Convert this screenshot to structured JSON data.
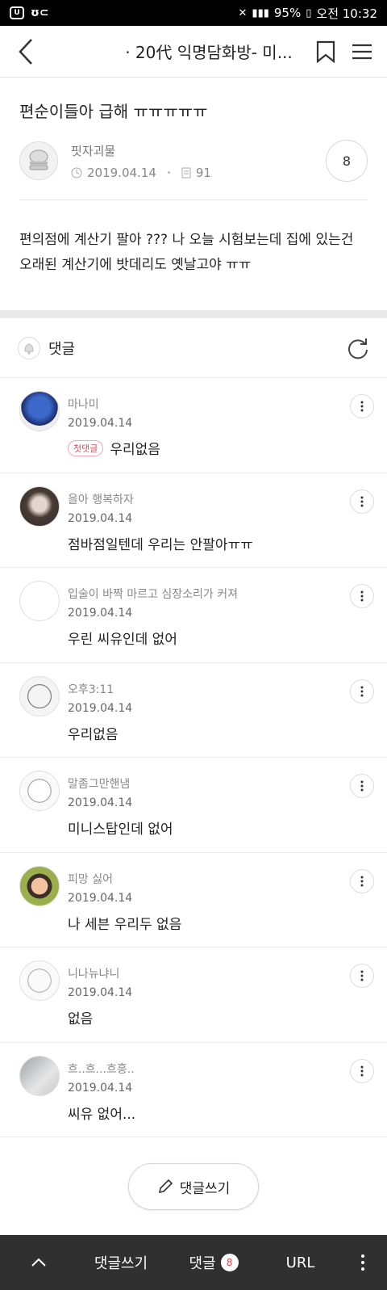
{
  "status_bar": {
    "battery": "95%",
    "time": "오전 10:32"
  },
  "header": {
    "title": "· 20代 익명담화방- 미..."
  },
  "post": {
    "title": "편순이들아 급해 ㅠㅠㅠㅠㅠ",
    "author": "핏자괴물",
    "date": "2019.04.14",
    "views": "91",
    "comment_count": "8",
    "body": "편의점에 계산기 팔아 ??? 나 오늘 시험보는데 집에 있는건 오래된 계산기에 밧데리도 옛날고야 ㅠㅠ"
  },
  "comments_section": {
    "label": "댓글"
  },
  "comments": [
    {
      "name": "마나미",
      "date": "2019.04.14",
      "text": "우리없음",
      "badge": "첫댓글"
    },
    {
      "name": "을아 행복하자",
      "date": "2019.04.14",
      "text": "점바점일텐데 우리는 안팔아ㅠㅠ"
    },
    {
      "name": "입술이 바짝 마르고 심장소리가 커져",
      "date": "2019.04.14",
      "text": "우린 씨유인데 없어"
    },
    {
      "name": "오후3:11",
      "date": "2019.04.14",
      "text": "우리없음"
    },
    {
      "name": "말좀그만핸냄",
      "date": "2019.04.14",
      "text": "미니스탑인데 없어"
    },
    {
      "name": "피망 싫어",
      "date": "2019.04.14",
      "text": "나 세븐 우리두 없음"
    },
    {
      "name": "니나뉴냐니",
      "date": "2019.04.14",
      "text": "없음"
    },
    {
      "name": "흐..흐...흐흥..",
      "date": "2019.04.14",
      "text": "씨유 없어..."
    }
  ],
  "write_button": {
    "label": "댓글쓰기"
  },
  "bottom_bar": {
    "write": "댓글쓰기",
    "comments": "댓글",
    "comments_badge": "8",
    "url": "URL"
  },
  "colors": {
    "accent": "#e5485a",
    "bottom_bar": "#303030"
  }
}
